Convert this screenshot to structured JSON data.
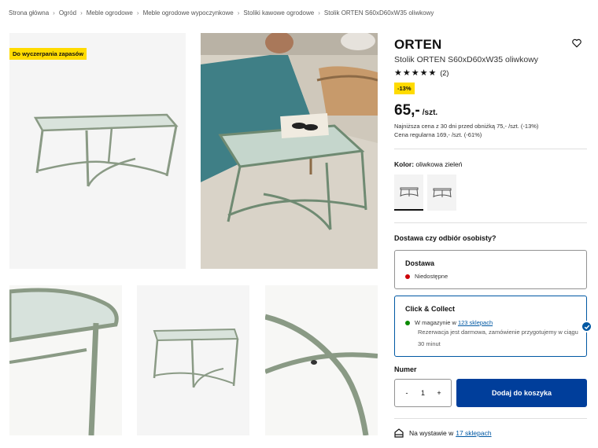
{
  "breadcrumb": [
    "Strona główna",
    "Ogród",
    "Meble ogrodowe",
    "Meble ogrodowe wypoczynkowe",
    "Stoliki kawowe ogrodowe",
    "Stolik ORTEN S60xD60xW35 oliwkowy"
  ],
  "breadcrumb_separator": "›",
  "gallery": {
    "stock_badge": "Do wyczerpania zapasów"
  },
  "product": {
    "name": "ORTEN",
    "description": "Stolik ORTEN S60xD60xW35 oliwkowy",
    "stars": "★★★★★",
    "rating": 5,
    "review_count": "(2)",
    "discount_badge": "-13%",
    "price": "65,-",
    "price_unit": "/szt.",
    "lowest_price_note": "Najniższa cena z 30 dni przed obniżką 75,- /szt. (-13%)",
    "regular_price_note": "Cena regularna 169,- /szt. (-61%)"
  },
  "color": {
    "label": "Kolor:",
    "value": "oliwkowa zieleń"
  },
  "delivery": {
    "question": "Dostawa czy odbiór osobisty?",
    "shipping": {
      "title": "Dostawa",
      "status": "Niedostępne",
      "status_color": "#cc0008"
    },
    "click_collect": {
      "title": "Click & Collect",
      "status_prefix": "W magazynie w",
      "status_link": "123 sklepach",
      "status_color": "#0a8a00",
      "note": "Rezerwacja jest darmowa, zamówienie przygotujemy w ciągu 30 minut"
    }
  },
  "quantity": {
    "label": "Numer",
    "decrement": "-",
    "value": "1",
    "increment": "+"
  },
  "cart": {
    "add_label": "Dodaj do koszyka"
  },
  "showroom": {
    "prefix": "Na wystawie w",
    "link": "17 sklepach"
  },
  "colors": {
    "accent_blue": "#003e9b",
    "badge_yellow": "#ffdb00",
    "table_green": "#8a9a85"
  }
}
